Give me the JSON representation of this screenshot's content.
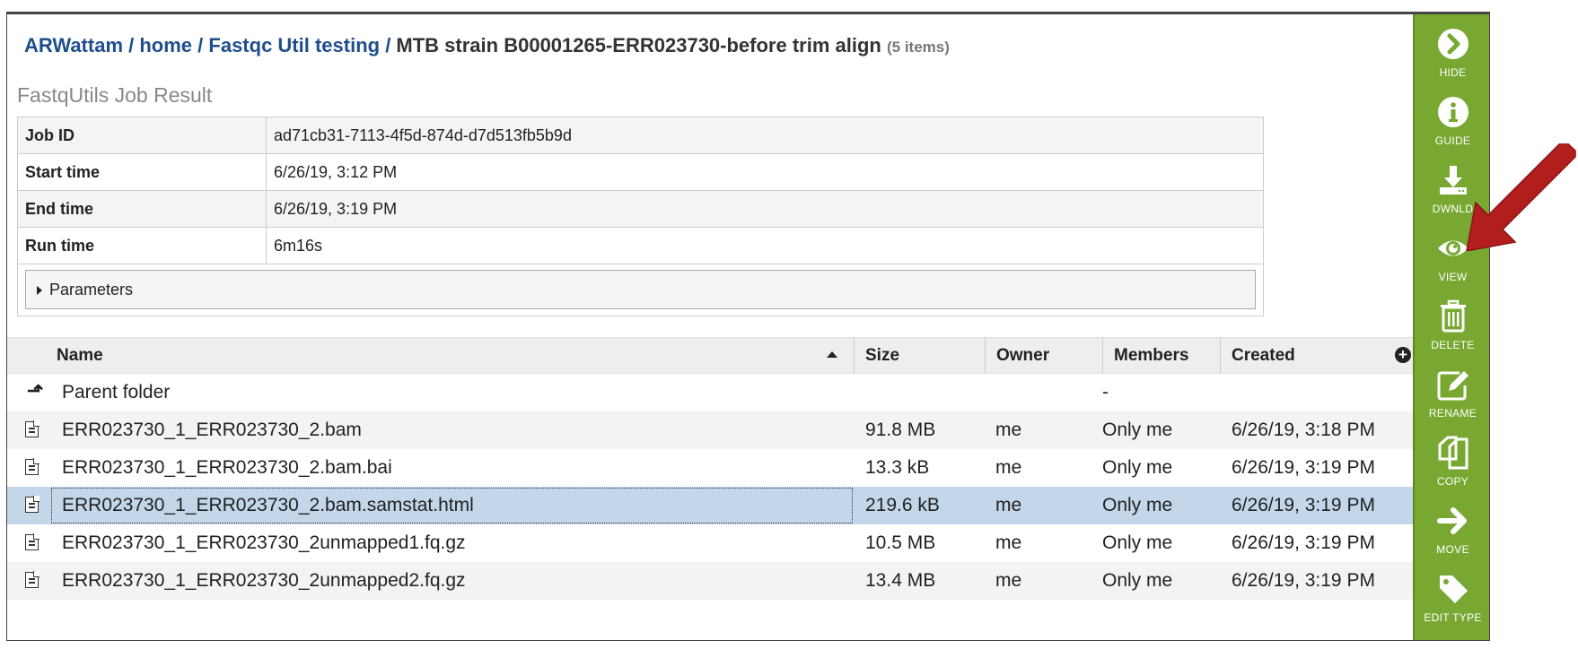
{
  "breadcrumb": {
    "user": "ARWattam",
    "home": "home",
    "folder": "Fastqc Util testing",
    "sep": " / ",
    "current": "MTB strain B00001265-ERR023730-before trim align",
    "count": "(5 items)"
  },
  "job": {
    "title": "FastqUtils Job Result",
    "rows": [
      {
        "key": "Job ID",
        "value": "ad71cb31-7113-4f5d-874d-d7d513fb5b9d"
      },
      {
        "key": "Start time",
        "value": "6/26/19, 3:12 PM"
      },
      {
        "key": "End time",
        "value": "6/26/19, 3:19 PM"
      },
      {
        "key": "Run time",
        "value": "6m16s"
      }
    ],
    "parameters_label": "Parameters"
  },
  "grid": {
    "columns": {
      "name": "Name",
      "size": "Size",
      "owner": "Owner",
      "members": "Members",
      "created": "Created"
    },
    "parent": {
      "name": "Parent folder",
      "members": "-"
    },
    "rows": [
      {
        "name": "ERR023730_1_ERR023730_2.bam",
        "size": "91.8 MB",
        "owner": "me",
        "members": "Only me",
        "created": "6/26/19, 3:18 PM"
      },
      {
        "name": "ERR023730_1_ERR023730_2.bam.bai",
        "size": "13.3 kB",
        "owner": "me",
        "members": "Only me",
        "created": "6/26/19, 3:19 PM"
      },
      {
        "name": "ERR023730_1_ERR023730_2.bam.samstat.html",
        "size": "219.6 kB",
        "owner": "me",
        "members": "Only me",
        "created": "6/26/19, 3:19 PM"
      },
      {
        "name": "ERR023730_1_ERR023730_2unmapped1.fq.gz",
        "size": "10.5 MB",
        "owner": "me",
        "members": "Only me",
        "created": "6/26/19, 3:19 PM"
      },
      {
        "name": "ERR023730_1_ERR023730_2unmapped2.fq.gz",
        "size": "13.4 MB",
        "owner": "me",
        "members": "Only me",
        "created": "6/26/19, 3:19 PM"
      }
    ],
    "selected_index": 2
  },
  "sidebar": {
    "buttons": [
      {
        "label": "HIDE",
        "icon": "hide-chevron-icon"
      },
      {
        "label": "GUIDE",
        "icon": "info-icon"
      },
      {
        "label": "DWNLD",
        "icon": "download-icon"
      },
      {
        "label": "VIEW",
        "icon": "eye-icon"
      },
      {
        "label": "DELETE",
        "icon": "trash-icon"
      },
      {
        "label": "RENAME",
        "icon": "edit-icon"
      },
      {
        "label": "COPY",
        "icon": "copy-icon"
      },
      {
        "label": "MOVE",
        "icon": "move-arrow-icon"
      },
      {
        "label": "EDIT TYPE",
        "icon": "tag-icon"
      }
    ]
  },
  "colors": {
    "accent_green": "#78a832",
    "link_blue": "#1f4e8c",
    "selected_row": "#c3d6ea",
    "annotation_arrow": "#b21e1e"
  }
}
